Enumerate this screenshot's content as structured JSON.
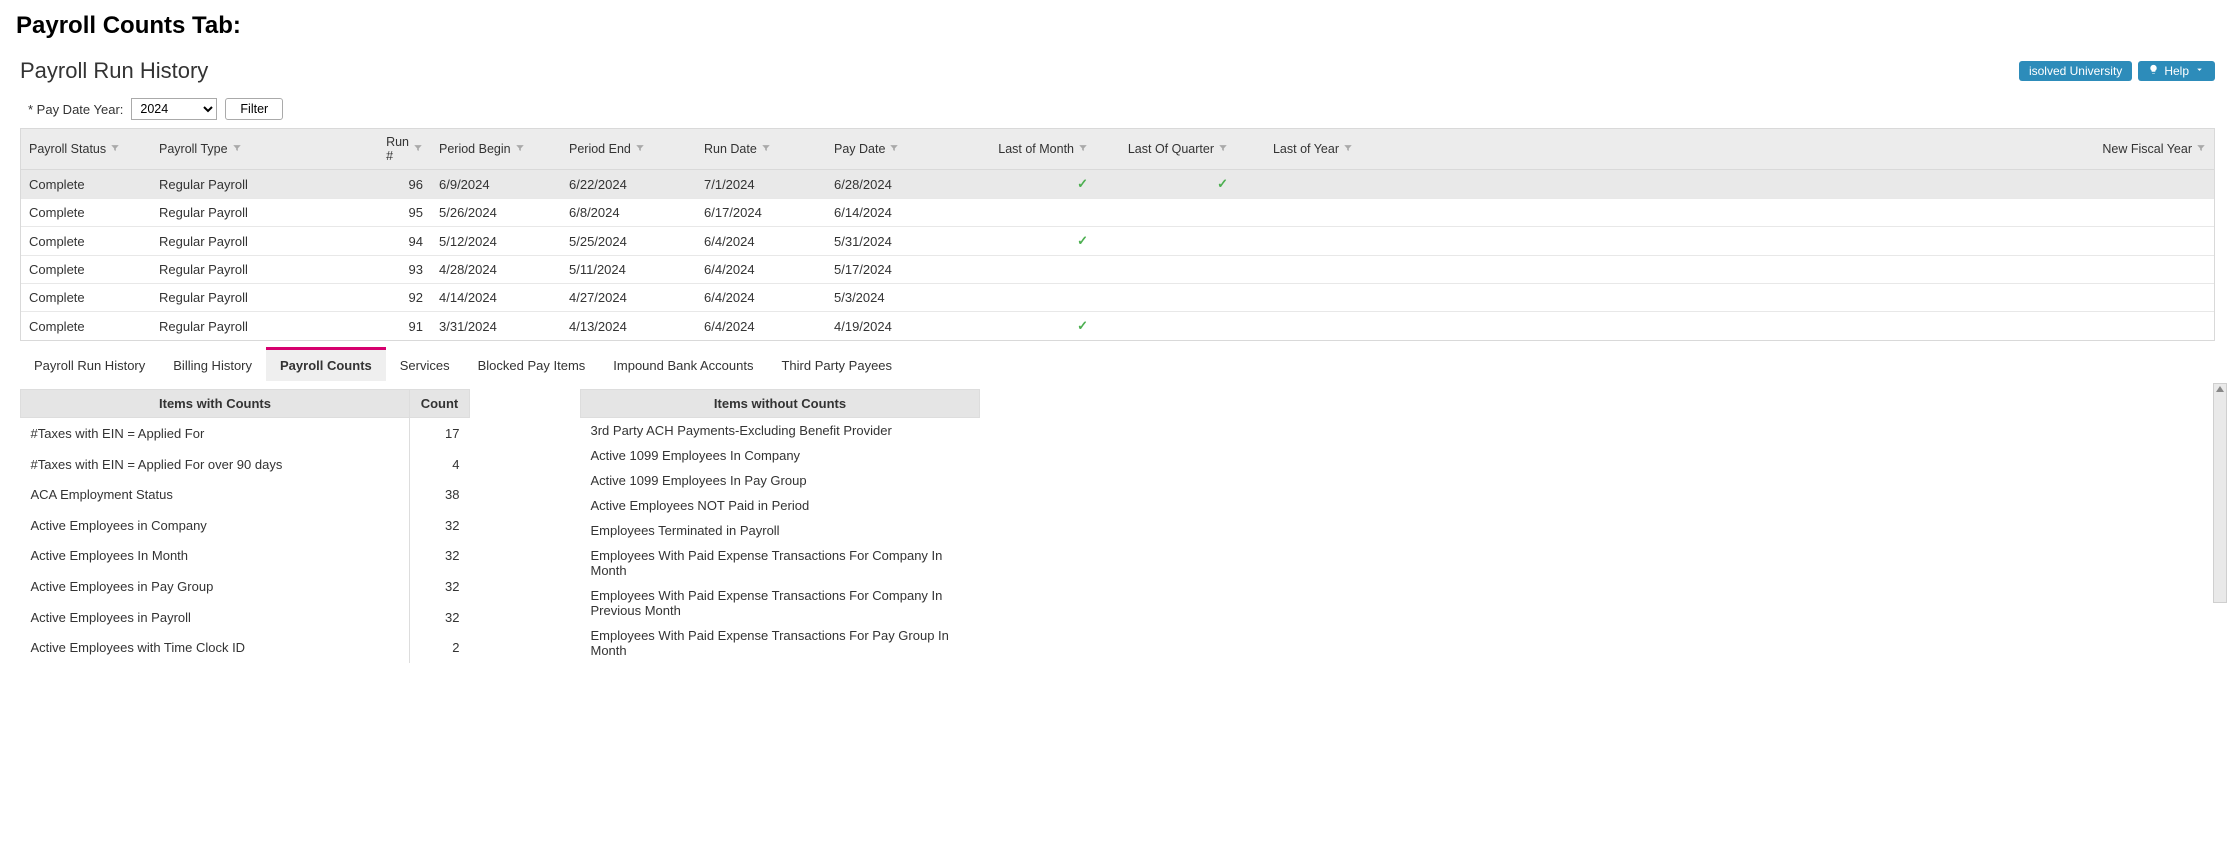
{
  "doc_heading": "Payroll Counts Tab:",
  "page_title": "Payroll Run History",
  "buttons": {
    "university": "isolved University",
    "help": "Help"
  },
  "filters": {
    "pay_date_year_label": "* Pay Date Year:",
    "pay_date_year_value": "2024",
    "filter_label": "Filter"
  },
  "grid": {
    "headers": {
      "status": "Payroll Status",
      "type": "Payroll Type",
      "run": "Run #",
      "period_begin": "Period Begin",
      "period_end": "Period End",
      "run_date": "Run Date",
      "pay_date": "Pay Date",
      "last_month": "Last of Month",
      "last_quarter": "Last Of Quarter",
      "last_year": "Last of Year",
      "new_fiscal": "New Fiscal Year"
    },
    "rows": [
      {
        "status": "Complete",
        "type": "Regular Payroll",
        "run": "96",
        "pb": "6/9/2024",
        "pe": "6/22/2024",
        "rd": "7/1/2024",
        "pd": "6/28/2024",
        "lm": true,
        "lq": true,
        "ly": false,
        "nfy": false,
        "sel": true
      },
      {
        "status": "Complete",
        "type": "Regular Payroll",
        "run": "95",
        "pb": "5/26/2024",
        "pe": "6/8/2024",
        "rd": "6/17/2024",
        "pd": "6/14/2024",
        "lm": false,
        "lq": false,
        "ly": false,
        "nfy": false
      },
      {
        "status": "Complete",
        "type": "Regular Payroll",
        "run": "94",
        "pb": "5/12/2024",
        "pe": "5/25/2024",
        "rd": "6/4/2024",
        "pd": "5/31/2024",
        "lm": true,
        "lq": false,
        "ly": false,
        "nfy": false
      },
      {
        "status": "Complete",
        "type": "Regular Payroll",
        "run": "93",
        "pb": "4/28/2024",
        "pe": "5/11/2024",
        "rd": "6/4/2024",
        "pd": "5/17/2024",
        "lm": false,
        "lq": false,
        "ly": false,
        "nfy": false
      },
      {
        "status": "Complete",
        "type": "Regular Payroll",
        "run": "92",
        "pb": "4/14/2024",
        "pe": "4/27/2024",
        "rd": "6/4/2024",
        "pd": "5/3/2024",
        "lm": false,
        "lq": false,
        "ly": false,
        "nfy": false
      },
      {
        "status": "Complete",
        "type": "Regular Payroll",
        "run": "91",
        "pb": "3/31/2024",
        "pe": "4/13/2024",
        "rd": "6/4/2024",
        "pd": "4/19/2024",
        "lm": true,
        "lq": false,
        "ly": false,
        "nfy": false
      }
    ]
  },
  "tabs": [
    {
      "label": "Payroll Run History",
      "active": false
    },
    {
      "label": "Billing History",
      "active": false
    },
    {
      "label": "Payroll Counts",
      "active": true
    },
    {
      "label": "Services",
      "active": false
    },
    {
      "label": "Blocked Pay Items",
      "active": false
    },
    {
      "label": "Impound Bank Accounts",
      "active": false
    },
    {
      "label": "Third Party Payees",
      "active": false
    }
  ],
  "counts": {
    "header_item": "Items with Counts",
    "header_count": "Count",
    "rows": [
      {
        "item": "#Taxes with EIN = Applied For",
        "count": "17"
      },
      {
        "item": "#Taxes with EIN = Applied For over 90 days",
        "count": "4"
      },
      {
        "item": "ACA Employment Status",
        "count": "38"
      },
      {
        "item": "Active Employees in Company",
        "count": "32"
      },
      {
        "item": "Active Employees In Month",
        "count": "32"
      },
      {
        "item": "Active Employees in Pay Group",
        "count": "32"
      },
      {
        "item": "Active Employees in Payroll",
        "count": "32"
      },
      {
        "item": "Active Employees with Time Clock ID",
        "count": "2"
      }
    ]
  },
  "nocounts": {
    "header": "Items without Counts",
    "rows": [
      "3rd Party ACH Payments-Excluding Benefit Provider",
      "Active 1099 Employees In Company",
      "Active 1099 Employees In Pay Group",
      "Active Employees NOT Paid in Period",
      "Employees Terminated in Payroll",
      "Employees With Paid Expense Transactions For Company In Month",
      "Employees With Paid Expense Transactions For Company In Previous Month",
      "Employees With Paid Expense Transactions For Pay Group In Month"
    ]
  }
}
